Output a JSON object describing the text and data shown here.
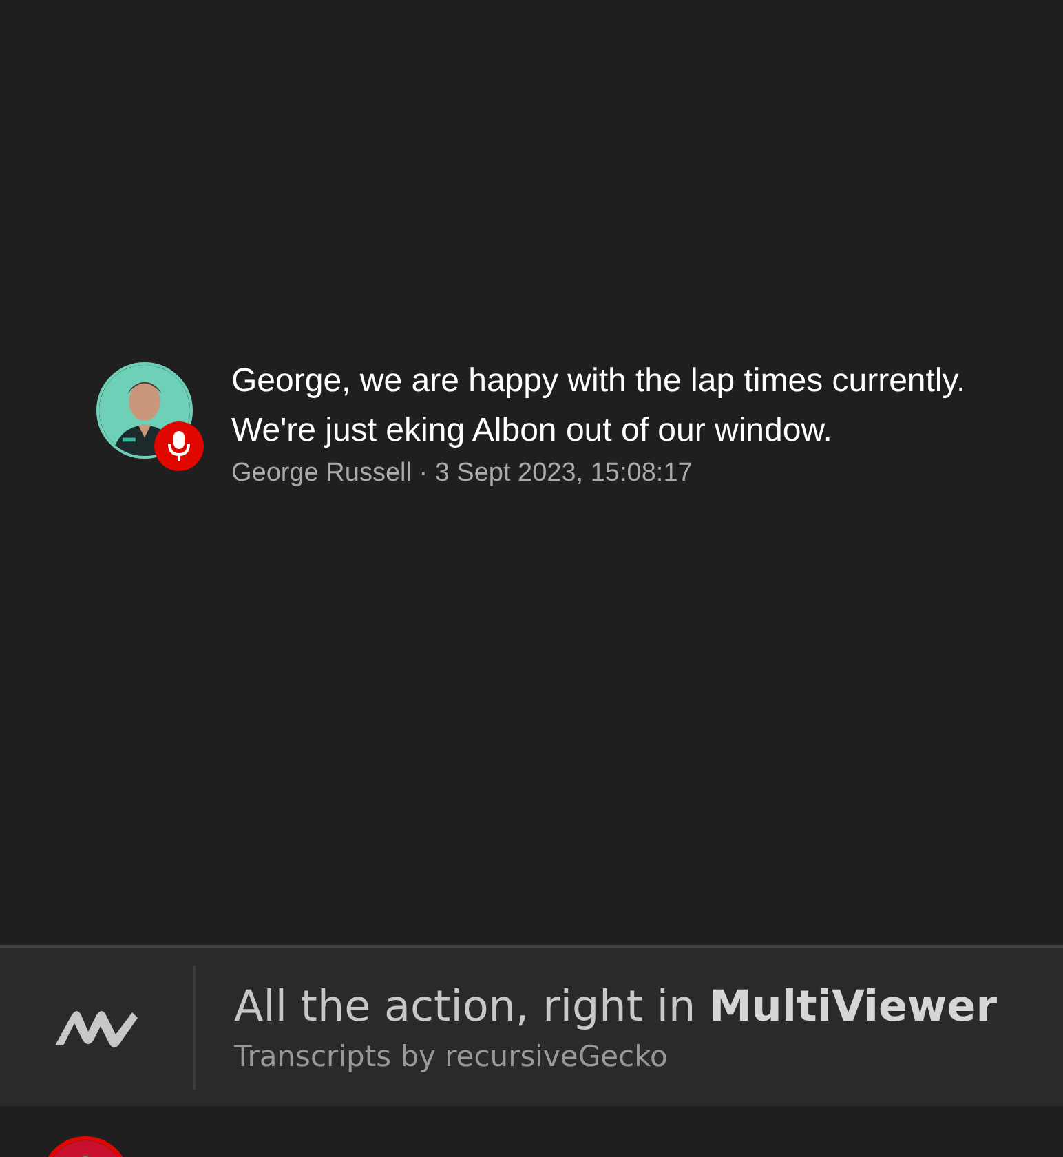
{
  "messages": [
    {
      "badge": {
        "kind": "microphone"
      },
      "text": "George, we are happy with the lap times currently. We're just eking Albon out of our window.",
      "meta": "George Russell · 3 Sept 2023, 15:08:17"
    }
  ],
  "banner": {
    "title": "All the action, right in **MultiViewer**",
    "subtitle": "Transcripts by recursiveGecko"
  }
}
